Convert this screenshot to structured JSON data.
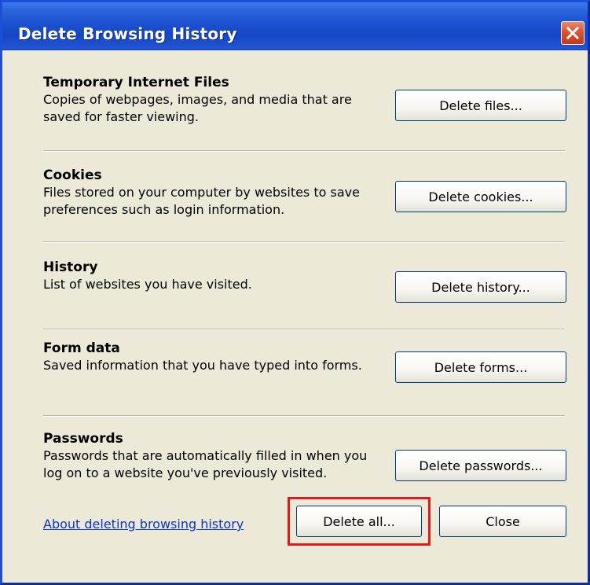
{
  "dialog": {
    "title": "Delete Browsing History",
    "close_icon": "close-icon"
  },
  "sections": [
    {
      "title": "Temporary Internet Files",
      "description": "Copies of webpages, images, and media that are saved for faster viewing.",
      "button_label": "Delete files..."
    },
    {
      "title": "Cookies",
      "description": "Files stored on your computer by websites to save preferences such as login information.",
      "button_label": "Delete cookies..."
    },
    {
      "title": "History",
      "description": "List of websites you have visited.",
      "button_label": "Delete history..."
    },
    {
      "title": "Form data",
      "description": "Saved information that you have typed into forms.",
      "button_label": "Delete forms..."
    },
    {
      "title": "Passwords",
      "description": "Passwords that are automatically filled in when you log on to a website you've previously visited.",
      "button_label": "Delete passwords..."
    }
  ],
  "footer": {
    "help_link": "About deleting browsing history",
    "delete_all_label": "Delete all...",
    "close_label": "Close"
  },
  "colors": {
    "titlebar": "#1b51cf",
    "dialog_bg": "#ece9d8",
    "link": "#0b34c4",
    "highlight": "#e01b1b"
  }
}
